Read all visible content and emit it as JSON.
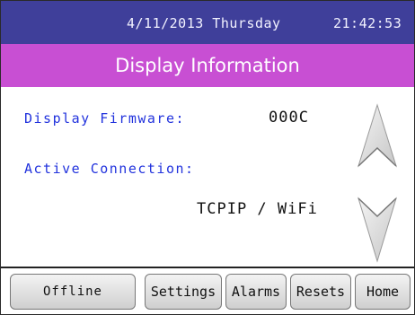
{
  "header": {
    "date": "4/11/2013 Thursday",
    "time": "21:42:53"
  },
  "title": "Display Information",
  "info": {
    "firmware_label": "Display Firmware:",
    "firmware_value": "000C",
    "connection_label": "Active Connection:",
    "connection_value": "TCPIP / WiFi"
  },
  "nav_icons": {
    "up": "chevron-up-icon",
    "down": "chevron-down-icon"
  },
  "bottom": {
    "offline": "Offline",
    "settings": "Settings",
    "alarms": "Alarms",
    "resets": "Resets",
    "home": "Home"
  },
  "colors": {
    "header_bg": "#3f3f9a",
    "title_bg": "#c84fd3",
    "label_text": "#2233dd"
  }
}
